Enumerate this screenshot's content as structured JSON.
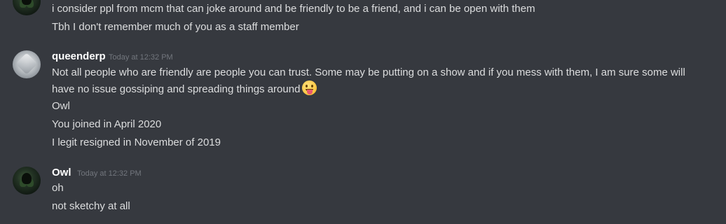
{
  "messages_top": {
    "lines": [
      "i consider ppl from mcm that can joke around and be friendly to be a friend, and i can be open with them",
      "Tbh I don't remember much of you as a staff member"
    ]
  },
  "message_queen": {
    "username": "queenderp",
    "timestamp": "Today at 12:32 PM",
    "line1": "Not all people who are friendly are people you can trust. Some may be putting on a show and if you mess with them, I am sure some will",
    "line2": "have no issue gossiping and spreading things around",
    "emoji_icon": "stuck-out-tongue-emoji",
    "followups": [
      "Owl",
      "You joined in April 2020",
      "I legit resigned in November of 2019"
    ]
  },
  "message_owl": {
    "username": "Owl",
    "timestamp": "Today at 12:32 PM",
    "lines": [
      "oh",
      "not sketchy at all"
    ]
  },
  "colors": {
    "background": "#36393f",
    "text": "#dcddde",
    "username": "#ffffff",
    "timestamp": "#72767d"
  }
}
